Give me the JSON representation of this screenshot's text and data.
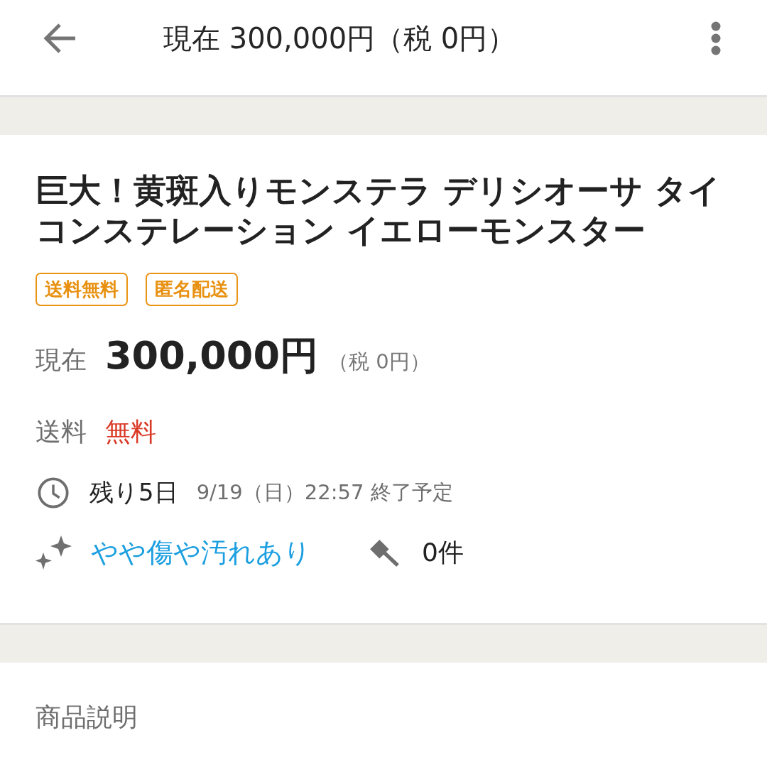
{
  "app_bar": {
    "title": "現在 300,000円（税 0円）"
  },
  "item": {
    "title": "巨大！黄斑入りモンステラ デリシオーサ タイコンステレーション イエローモンスター",
    "tags": [
      {
        "label": "送料無料"
      },
      {
        "label": "匿名配送"
      }
    ],
    "price": {
      "label": "現在",
      "amount": "300,000円",
      "tax": "（税 0円）"
    },
    "shipping": {
      "label": "送料",
      "value": "無料"
    },
    "time_left": {
      "remaining": "残り5日",
      "end": "9/19（日）22:57 終了予定"
    },
    "condition": "やや傷や汚れあり",
    "bids": "0件"
  },
  "description": {
    "heading": "商品説明"
  }
}
